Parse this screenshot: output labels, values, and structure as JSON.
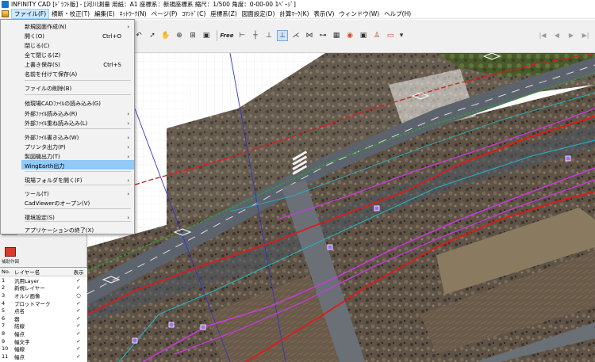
{
  "window": {
    "title": "INFINITY CAD [ﾄﾞﾗﾌﾄ版] - [河川測量 用紙：A1 座標系：新規座標系 縮尺：1/500 角度：0-00-00 1ﾍﾟｰｼﾞ]"
  },
  "menubar": {
    "items": [
      "ファイル(F)",
      "横断・校正(T)",
      "編集(E)",
      "ﾈｯﾄﾜｰｸ(N)",
      "ページ(P)",
      "ｺﾏﾝﾄﾞ(C)",
      "座標系(Z)",
      "図面設定(D)",
      "計算ﾏｰｸ(K)",
      "表示(V)",
      "ウィンドウ(W)",
      "ヘルプ(H)"
    ]
  },
  "toolbar": {
    "free_label": "Free"
  },
  "file_menu": {
    "items": [
      {
        "label": "新規図面作成(N)",
        "shortcut": "",
        "submenu": true
      },
      {
        "label": "開く(O)",
        "shortcut": "Ctrl+O",
        "submenu": false
      },
      {
        "label": "閉じる(C)",
        "shortcut": "",
        "submenu": false
      },
      {
        "label": "全て閉じる(Z)",
        "shortcut": "",
        "submenu": false
      },
      {
        "label": "上書き保存(S)",
        "shortcut": "Ctrl+S",
        "submenu": false
      },
      {
        "label": "名前を付けて保存(A)",
        "shortcut": "",
        "submenu": false
      },
      {
        "label": "ファイルの削除(B)",
        "shortcut": "",
        "submenu": false
      },
      {
        "label": "他現場CADﾌｧｲﾙの読み込み(G)",
        "shortcut": "",
        "submenu": false
      },
      {
        "label": "外部ﾌｧｲﾙ読み込み(R)",
        "shortcut": "",
        "submenu": true
      },
      {
        "label": "外部ﾌｧｲﾙ重ね読み込み(L)",
        "shortcut": "",
        "submenu": true
      },
      {
        "label": "外部ﾌｧｲﾙ書き込み(W)",
        "shortcut": "",
        "submenu": true
      },
      {
        "label": "プリンタ出力(P)",
        "shortcut": "",
        "submenu": true
      },
      {
        "label": "製図機出力(T)",
        "shortcut": "",
        "submenu": true
      },
      {
        "label": "WingEarth出力",
        "shortcut": "",
        "submenu": false
      },
      {
        "label": "現場フォルダを開く(F)",
        "shortcut": "",
        "submenu": true
      },
      {
        "label": "ツール(T)",
        "shortcut": "",
        "submenu": true
      },
      {
        "label": "CadViewerのオープン(V)",
        "shortcut": "",
        "submenu": false
      },
      {
        "label": "環境設定(S)",
        "shortcut": "",
        "submenu": true
      },
      {
        "label": "アプリケーションの終了(X)",
        "shortcut": "",
        "submenu": false
      }
    ],
    "highlighted": "WingEarth出力"
  },
  "side_tools": {
    "caption": "補助作図"
  },
  "layer_table": {
    "headers": {
      "no": "No.",
      "name": "レイヤー名",
      "display": "表示"
    },
    "rows": [
      {
        "no": "1",
        "name": "汎用Layer",
        "display": "✓"
      },
      {
        "no": "2",
        "name": "新規レイヤー",
        "display": "✓"
      },
      {
        "no": "3",
        "name": "オルソ画像",
        "display": "○"
      },
      {
        "no": "4",
        "name": "プロットマーク",
        "display": "✓"
      },
      {
        "no": "5",
        "name": "点名",
        "display": "✓"
      },
      {
        "no": "6",
        "name": "器",
        "display": "✓"
      },
      {
        "no": "7",
        "name": "結線",
        "display": "✓"
      },
      {
        "no": "8",
        "name": "幅点",
        "display": "✓"
      },
      {
        "no": "9",
        "name": "幅文字",
        "display": "✓"
      },
      {
        "no": "10",
        "name": "幅線",
        "display": "✓"
      },
      {
        "no": "11",
        "name": "幅点",
        "display": "✓"
      }
    ]
  },
  "colors": {
    "highlight": "#91c9f7",
    "menu_active": "#cce8ff",
    "alignment_red": "#e11919",
    "alignment_magenta": "#c63bd9",
    "centerline_green": "#2fa32f",
    "cyan_line": "#1fb5c9",
    "blue_line": "#3333cc"
  }
}
